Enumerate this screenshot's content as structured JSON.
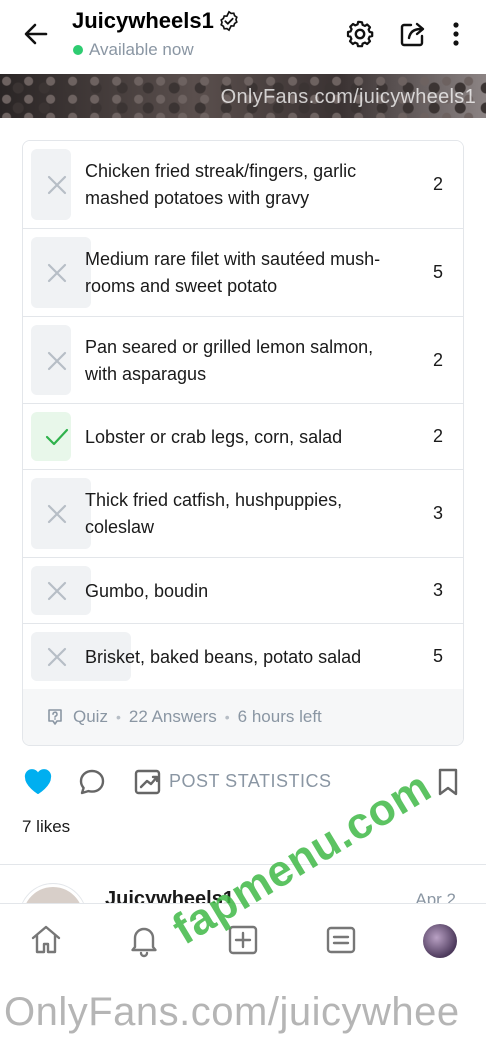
{
  "header": {
    "name": "Juicywheels1",
    "status": "Available now"
  },
  "banner": {
    "watermark": "OnlyFans.com/juicywheels1"
  },
  "quiz": {
    "options": [
      {
        "text": "Chicken fried streak/fingers, garlic mashed potatoes with gravy",
        "count": "2",
        "correct": false
      },
      {
        "text": "Medium rare filet with sautéed mush-rooms and sweet potato",
        "count": "5",
        "correct": false
      },
      {
        "text": "Pan seared or grilled lemon salmon, with asparagus",
        "count": "2",
        "correct": false
      },
      {
        "text": "Lobster or crab legs, corn, salad",
        "count": "2",
        "correct": true
      },
      {
        "text": "Thick fried catfish, hushpuppies, coleslaw",
        "count": "3",
        "correct": false
      },
      {
        "text": "Gumbo, boudin",
        "count": "3",
        "correct": false
      },
      {
        "text": "Brisket, baked beans, potato salad",
        "count": "5",
        "correct": false
      }
    ],
    "type_label": "Quiz",
    "answers": "22 Answers",
    "time_left": "6 hours left"
  },
  "actions": {
    "stats_label": "POST STATISTICS",
    "likes": "7 likes"
  },
  "next_post": {
    "name": "Juicywheels1",
    "date": "Apr 2"
  },
  "watermarks": {
    "bottom": "OnlyFans.com/juicywhee",
    "diagonal": "fapmenu.com"
  },
  "colors": {
    "accent": "#00aff0",
    "muted": "#8a96a3",
    "correct": "#2fb24c",
    "online": "#2ecc71"
  }
}
